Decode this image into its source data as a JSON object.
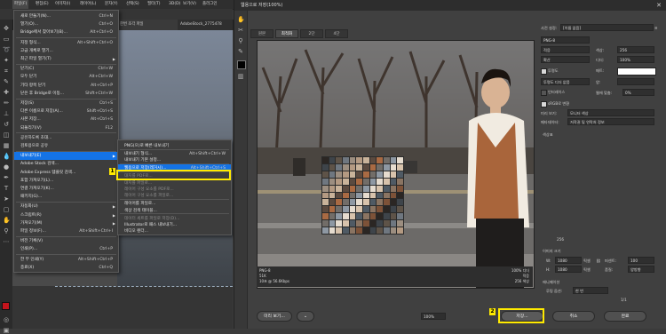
{
  "menubar": {
    "items": [
      "파일(F)",
      "편집(E)",
      "이미지(I)",
      "레이어(L)",
      "문자(Y)",
      "선택(S)",
      "필터(T)",
      "3D(D)",
      "보기(V)",
      "플러그인",
      "창(W)",
      "도움말(H)"
    ]
  },
  "document": {
    "tabs": [
      "한번 조각 파일",
      "AdobeStock_2775478"
    ]
  },
  "file_menu": {
    "items": [
      {
        "label": "새로 만들기(N)...",
        "shortcut": "Ctrl+N"
      },
      {
        "label": "열기(O)...",
        "shortcut": "Ctrl+O"
      },
      {
        "label": "Bridge에서 찾아보기(B)...",
        "shortcut": "Alt+Ctrl+O"
      },
      {
        "label": "지정 형식...",
        "shortcut": "Alt+Shift+Ctrl+O"
      },
      {
        "label": "고급 개체로 열기...",
        "shortcut": ""
      },
      {
        "label": "최근 파일 열기(T)",
        "shortcut": "",
        "arrow": true
      },
      {
        "label": "닫기(C)",
        "shortcut": "Ctrl+W"
      },
      {
        "label": "모두 닫기",
        "shortcut": "Alt+Ctrl+W"
      },
      {
        "label": "기타 항목 닫기",
        "shortcut": "Alt+Ctrl+P"
      },
      {
        "label": "닫은 후 Bridge로 이동...",
        "shortcut": "Shift+Ctrl+W"
      },
      {
        "label": "저장(S)",
        "shortcut": "Ctrl+S"
      },
      {
        "label": "다른 이름으로 저장(A)...",
        "shortcut": "Shift+Ctrl+S"
      },
      {
        "label": "사본 저장...",
        "shortcut": "Alt+Ctrl+S"
      },
      {
        "label": "되돌리기(V)",
        "shortcut": "F12"
      },
      {
        "label": "공유하도록 초대...",
        "shortcut": ""
      },
      {
        "label": "검토용으로 공유",
        "shortcut": ""
      },
      {
        "label": "내보내기(E)",
        "shortcut": "",
        "arrow": true,
        "highlighted": true
      },
      {
        "label": "Adobe Stock 검색...",
        "shortcut": ""
      },
      {
        "label": "Adobe Express 템플릿 검색...",
        "shortcut": ""
      },
      {
        "label": "포함 가져오기(L)...",
        "shortcut": ""
      },
      {
        "label": "연결 가져오기(K)...",
        "shortcut": ""
      },
      {
        "label": "패키지(G)...",
        "shortcut": ""
      },
      {
        "label": "자동화(U)",
        "shortcut": "",
        "arrow": true
      },
      {
        "label": "스크립트(R)",
        "shortcut": "",
        "arrow": true
      },
      {
        "label": "가져오기(M)",
        "shortcut": "",
        "arrow": true
      },
      {
        "label": "파일 정보(F)...",
        "shortcut": "Alt+Shift+Ctrl+I"
      },
      {
        "label": "버전 기록(V)",
        "shortcut": ""
      },
      {
        "label": "인쇄(P)...",
        "shortcut": "Ctrl+P"
      },
      {
        "label": "한 부 인쇄(Y)",
        "shortcut": "Alt+Shift+Ctrl+P"
      },
      {
        "label": "종료(X)",
        "shortcut": "Ctrl+Q"
      }
    ]
  },
  "export_menu": {
    "items": [
      {
        "label": "PNG(으)로 빠른 내보내기",
        "shortcut": ""
      },
      {
        "label": "내보내기 형식...",
        "shortcut": "Alt+Shift+Ctrl+W"
      },
      {
        "label": "내보내기 기본 설정...",
        "shortcut": ""
      },
      {
        "label": "웹용으로 저장(레거시)...",
        "shortcut": "Alt+Shift+Ctrl+S",
        "highlighted": true
      },
      {
        "label": "대지를 PDF로...",
        "shortcut": "",
        "disabled": true
      },
      {
        "label": "대지를 파일로...",
        "shortcut": "",
        "disabled": true
      },
      {
        "label": "레이어 구성 요소를 PDF로...",
        "shortcut": "",
        "disabled": true
      },
      {
        "label": "레이어 구성 요소를 파일로...",
        "shortcut": "",
        "disabled": true
      },
      {
        "label": "레이어를 파일로...",
        "shortcut": ""
      },
      {
        "label": "색상 검색 테이블...",
        "shortcut": ""
      },
      {
        "label": "데이터 세트를 파일로 저장(D)...",
        "shortcut": "",
        "disabled": true
      },
      {
        "label": "Illustrator로 패스 내보내기...",
        "shortcut": ""
      },
      {
        "label": "비디오 렌더...",
        "shortcut": ""
      }
    ]
  },
  "callouts": {
    "one": "1",
    "two": "2"
  },
  "dialog": {
    "title": "웹용으로 저장(100%)",
    "close": "✕",
    "tabs": [
      "원본",
      "최적화",
      "2단",
      "4단"
    ],
    "info_left": [
      "PNG-8",
      "51K",
      "10초 @ 56.6Kbps"
    ],
    "info_right": [
      "100% 디더",
      "적응",
      "256 색상"
    ],
    "zoom": "100%",
    "preview_btn": "미리 보기...",
    "save_btn": "저장...",
    "cancel_btn": "취소",
    "done_btn": "완료",
    "settings": {
      "preset_label": "사전 설정:",
      "preset_value": "[이름 없음]",
      "format": "PNG-8",
      "reduction": "적응",
      "colors": "256",
      "dither_algo": "확산",
      "dither": "100%",
      "transparency": "투명도",
      "matte": "매트:",
      "no_transparency_dither": "투명도 디더 없음",
      "amount": "양:",
      "interlaced": "인터레이스",
      "web_snap": "웹에 맞춤:",
      "web_snap_value": "0%",
      "embed_color_profile": "sRGB로 변환",
      "preview_label": "미리 보기:",
      "preview_value": "모니터 색상",
      "metadata_label": "메타데이터:",
      "metadata_value": "저작권 및 연락처 정보",
      "color_table": "색상표",
      "palette_count": "256",
      "image_size": "이미지 크기",
      "w_label": "W:",
      "w_value": "1080",
      "h_label": "H:",
      "h_value": "1080",
      "px": "픽셀",
      "percent_label": "퍼센트:",
      "percent_value": "100",
      "quality_label": "품질:",
      "quality_value": "양방향",
      "animation": "애니메이션",
      "loop_label": "루핑 옵션:",
      "loop_value": "한 번",
      "frame": "1/1"
    }
  },
  "colors": {
    "highlight": "#1473e6",
    "callout": "#ffea00",
    "panel": "#404040"
  }
}
